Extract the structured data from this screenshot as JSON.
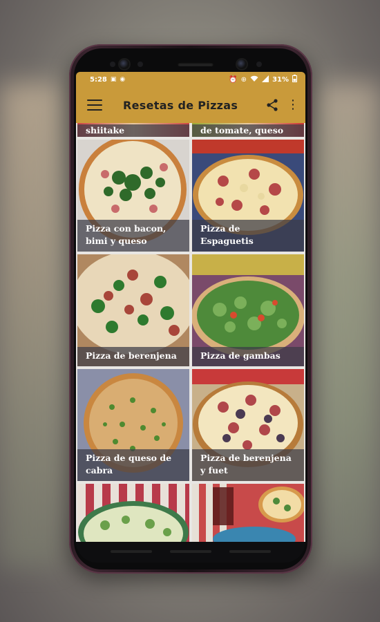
{
  "status_bar": {
    "time": "5:28",
    "battery": "31%",
    "icons": [
      "gallery-icon",
      "notification-icon",
      "alarm-icon",
      "gps-icon",
      "wifi-icon",
      "signal-icon",
      "battery-icon"
    ]
  },
  "app_bar": {
    "title": "Resetas  de Pizzas",
    "menu_icon": "menu-icon",
    "share_icon": "share-icon",
    "more_icon": "more-vert-icon"
  },
  "recipes": {
    "partial_top": [
      {
        "title": "shiitake"
      },
      {
        "title": "de tomate, queso"
      }
    ],
    "items": [
      {
        "title": "Pizza con bacon, bimi y queso"
      },
      {
        "title": "Pizza de Espaguetis"
      },
      {
        "title": "Pizza de berenjena"
      },
      {
        "title": "Pizza de gambas"
      },
      {
        "title": "Pizza de queso de cabra"
      },
      {
        "title": "Pizza de berenjena y fuet"
      }
    ]
  },
  "colors": {
    "accent": "#c99a3a",
    "caption_bg": "#3c3c46",
    "frame": "#3c2530"
  }
}
